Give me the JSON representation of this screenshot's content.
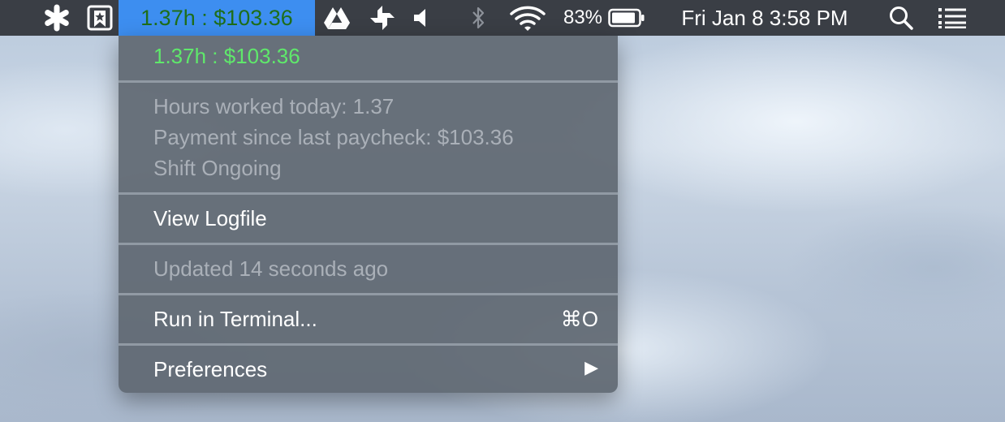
{
  "menubar": {
    "status_text": "1.37h : $103.36",
    "battery_percent": "83%",
    "clock": "Fri Jan 8  3:58 PM",
    "icons": [
      "asterisk-icon",
      "bookmark-star-icon",
      "google-drive-icon",
      "pinwheel-icon",
      "volume-icon",
      "bluetooth-icon",
      "wifi-icon",
      "battery-icon",
      "search-icon",
      "list-icon"
    ]
  },
  "menu": {
    "header": "1.37h : $103.36",
    "hours_line": "Hours worked today: 1.37",
    "payment_line": "Payment since last paycheck: $103.36",
    "shift_line": "Shift Ongoing",
    "view_logfile": "View Logfile",
    "updated": "Updated 14 seconds ago",
    "run_terminal": "Run in Terminal...",
    "run_terminal_shortcut": "⌘O",
    "preferences": "Preferences",
    "submenu_arrow": "▶"
  },
  "colors": {
    "accent": "#3d8ef0",
    "status_green": "#5fe86b",
    "menubar_bg": "#3a3e45"
  }
}
